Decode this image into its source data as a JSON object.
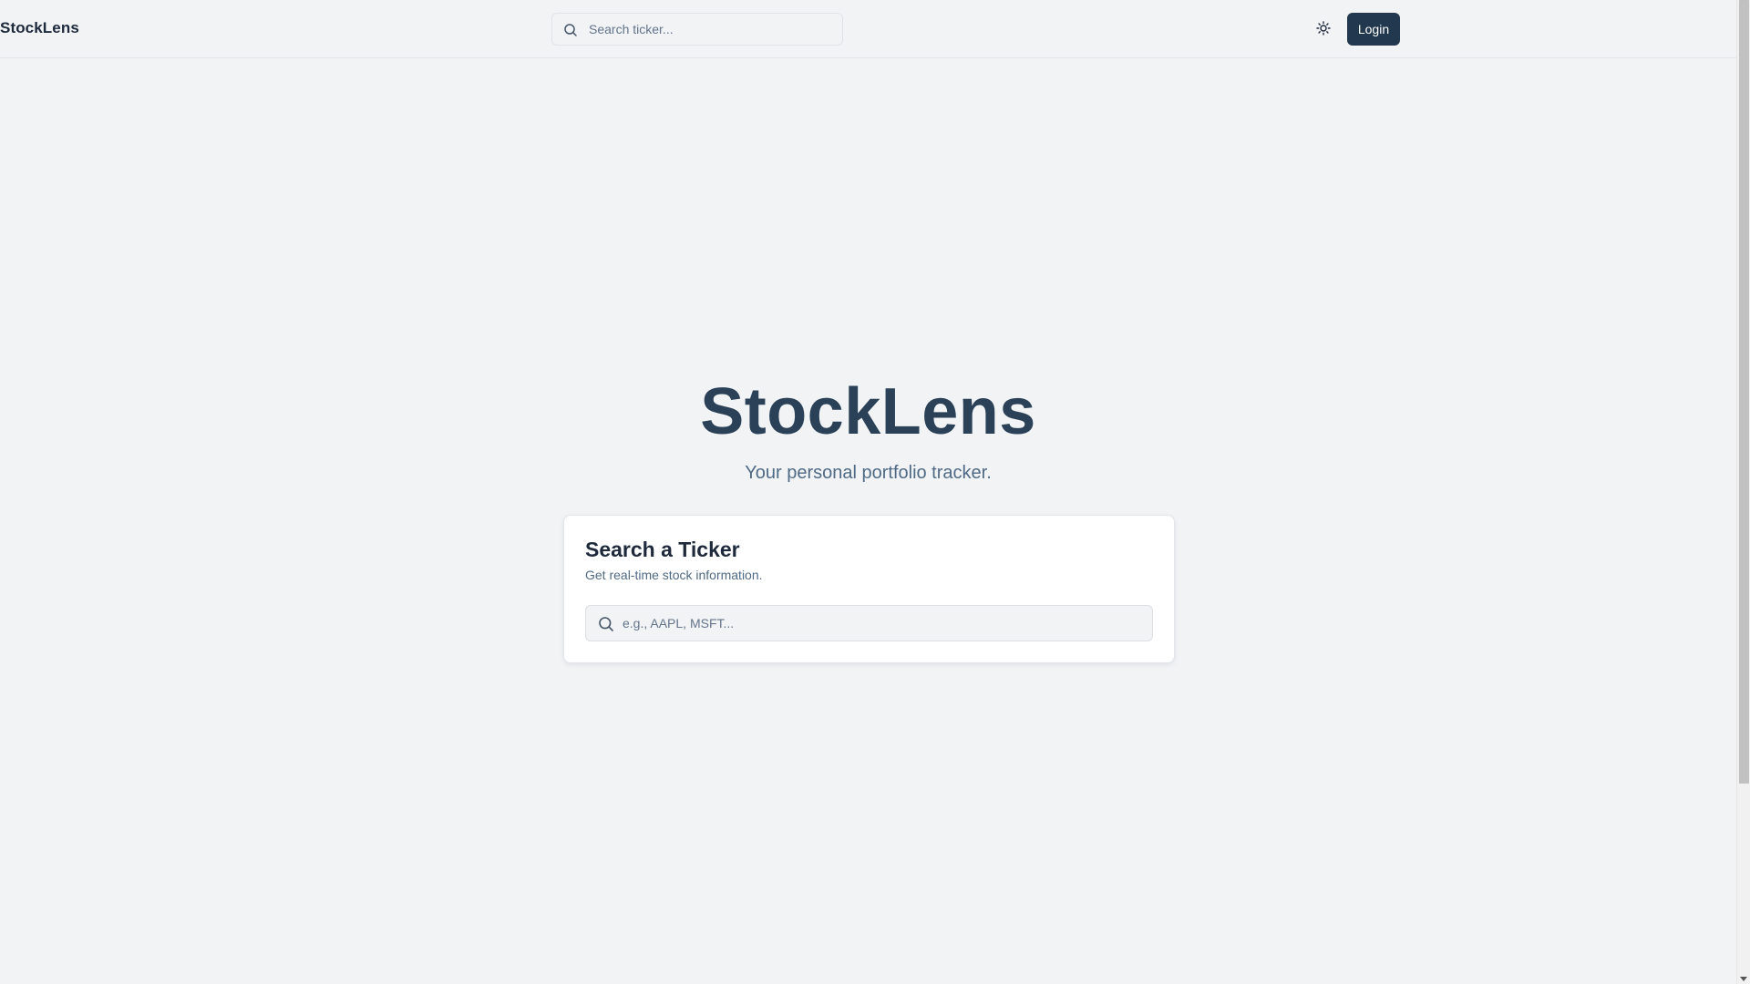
{
  "header": {
    "brand": "StockLens",
    "search": {
      "placeholder": "Search ticker...",
      "value": "",
      "icon": "search-icon"
    },
    "theme_toggle": {
      "icon": "sun-icon"
    },
    "login_label": "Login"
  },
  "hero": {
    "title": "StockLens",
    "subtitle": "Your personal portfolio tracker."
  },
  "card": {
    "title": "Search a Ticker",
    "description": "Get real-time stock information.",
    "search": {
      "placeholder": "e.g., AAPL, MSFT...",
      "value": "",
      "icon": "search-icon"
    }
  },
  "colors": {
    "background": "#f1f3f5",
    "accent": "#22384f",
    "hero_title": "#2a4158",
    "muted_text": "#4f6a84"
  }
}
